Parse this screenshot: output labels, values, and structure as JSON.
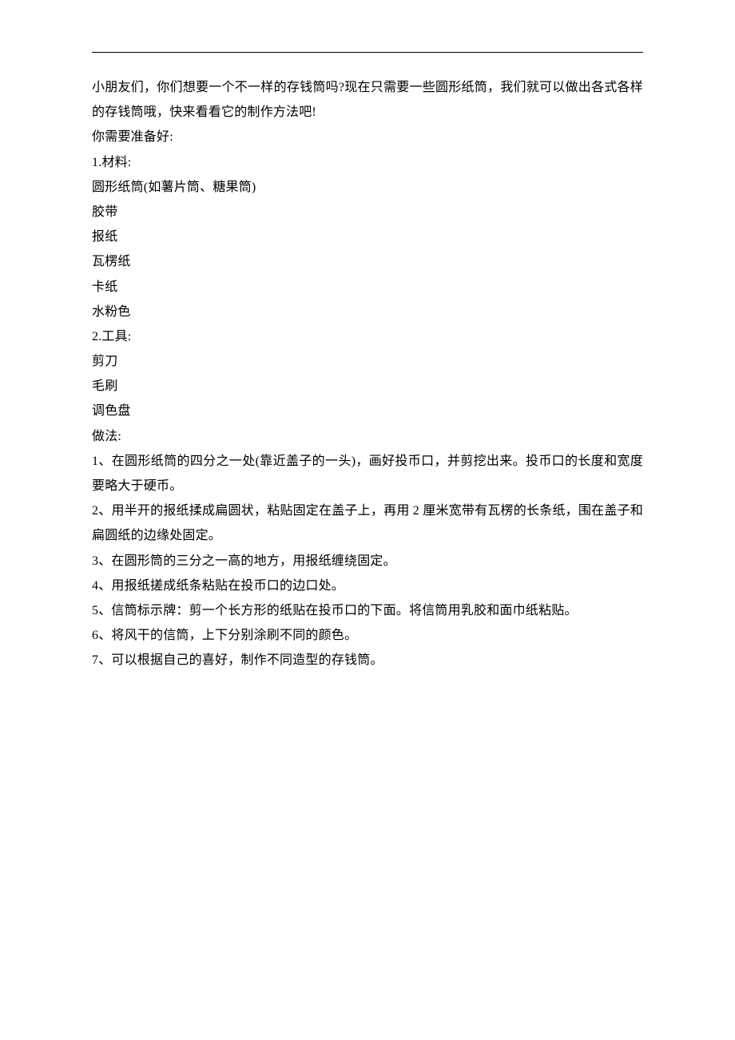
{
  "intro": "小朋友们，你们想要一个不一样的存钱筒吗?现在只需要一些圆形纸筒，我们就可以做出各式各样的存钱筒哦，快来看看它的制作方法吧!",
  "prepare_label": "你需要准备好:",
  "materials_label": "1.材料:",
  "materials": [
    "圆形纸筒(如薯片筒、糖果筒)",
    "胶带",
    "报纸",
    "瓦楞纸",
    "卡纸",
    "水粉色"
  ],
  "tools_label": "2.工具:",
  "tools": [
    "剪刀",
    "毛刷",
    "调色盘"
  ],
  "method_label": "做法:",
  "steps": [
    "1、在圆形纸筒的四分之一处(靠近盖子的一头)，画好投币口，并剪挖出来。投币口的长度和宽度要略大于硬币。",
    "2、用半开的报纸揉成扁圆状，粘贴固定在盖子上，再用 2 厘米宽带有瓦楞的长条纸，围在盖子和扁圆纸的边缘处固定。",
    "3、在圆形筒的三分之一高的地方，用报纸缠绕固定。",
    "4、用报纸搓成纸条粘贴在投币口的边口处。",
    "5、信筒标示牌：剪一个长方形的纸贴在投币口的下面。将信筒用乳胶和面巾纸粘贴。",
    "6、将风干的信筒，上下分别涂刷不同的颜色。",
    "7、可以根据自己的喜好，制作不同造型的存钱筒。"
  ]
}
